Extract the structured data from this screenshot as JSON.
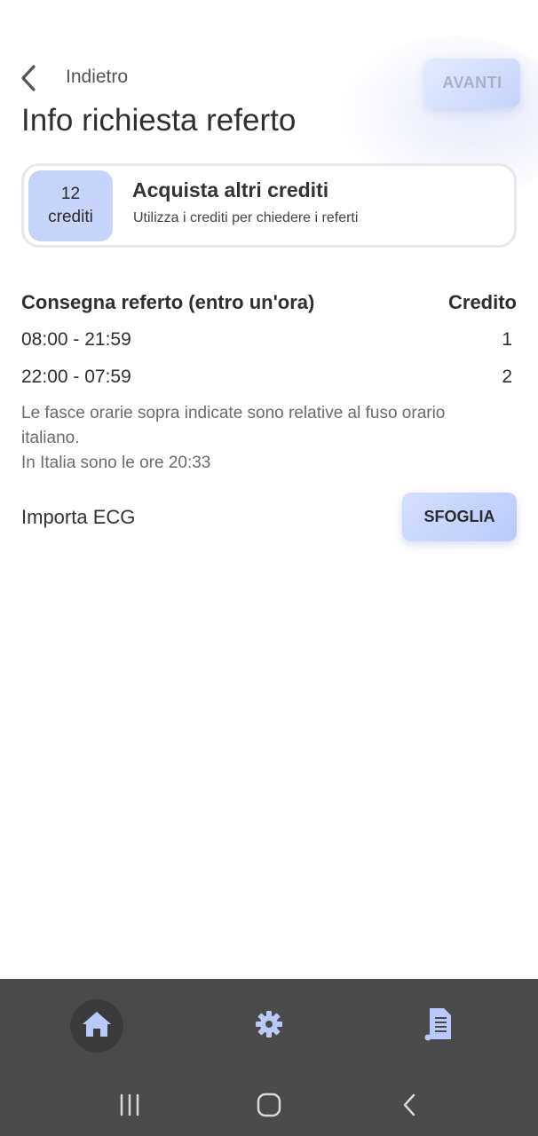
{
  "header": {
    "back_label": "Indietro",
    "next_label": "AVANTI",
    "title": "Info richiesta referto"
  },
  "credits": {
    "count": "12",
    "unit": "crediti",
    "title": "Acquista altri crediti",
    "subtitle": "Utilizza i crediti per chiedere i referti"
  },
  "delivery_table": {
    "header_left": "Consegna referto (entro un'ora)",
    "header_right": "Credito",
    "rows": [
      {
        "time": "08:00 - 21:59",
        "credit": "1"
      },
      {
        "time": "22:00 - 07:59",
        "credit": "2"
      }
    ]
  },
  "notes": {
    "timezone": "Le fasce orarie sopra indicate sono relative al fuso orario italiano.",
    "current_time": "In Italia sono le ore 20:33"
  },
  "import": {
    "label": "Importa ECG",
    "button": "SFOGLIA"
  },
  "bottom_nav": {
    "items": [
      {
        "icon": "home-icon",
        "active": true
      },
      {
        "icon": "gear-icon",
        "active": false
      },
      {
        "icon": "report-document-icon",
        "active": false
      }
    ]
  },
  "colors": {
    "accent": "#c8d5fb",
    "button_gradient_start": "#d5e0ff",
    "nav_icon": "#b9c9fa",
    "nav_background": "#4a4a4a"
  }
}
